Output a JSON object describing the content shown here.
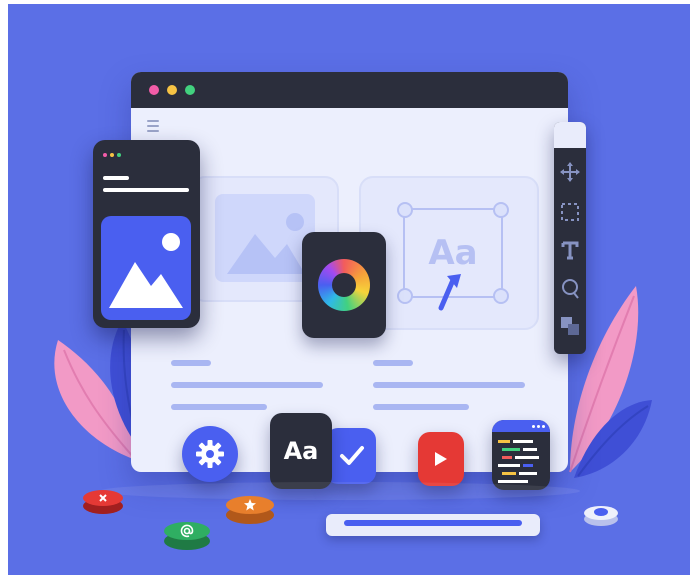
{
  "illustration": {
    "colors": {
      "background": "#5b6fe6",
      "dark_panel": "#2b2e3c",
      "page_surface": "#eceffd",
      "accent_blue": "#4a5ff0",
      "leaf_pink": "#f29ac6",
      "button_red": "#e53935",
      "button_orange": "#e87f2c",
      "button_green": "#2fae62"
    },
    "browser_dots": [
      "#f25ca8",
      "#f6c344",
      "#42d17f"
    ],
    "toolbar_tools": [
      "move-icon",
      "selection-icon",
      "text-tool-icon",
      "lasso-icon",
      "layers-icon"
    ],
    "typography_tile_text": "Aa",
    "canvas_sample_text": "Aa",
    "floating_buttons": [
      "close-icon",
      "star-icon",
      "at-sign-icon"
    ]
  }
}
